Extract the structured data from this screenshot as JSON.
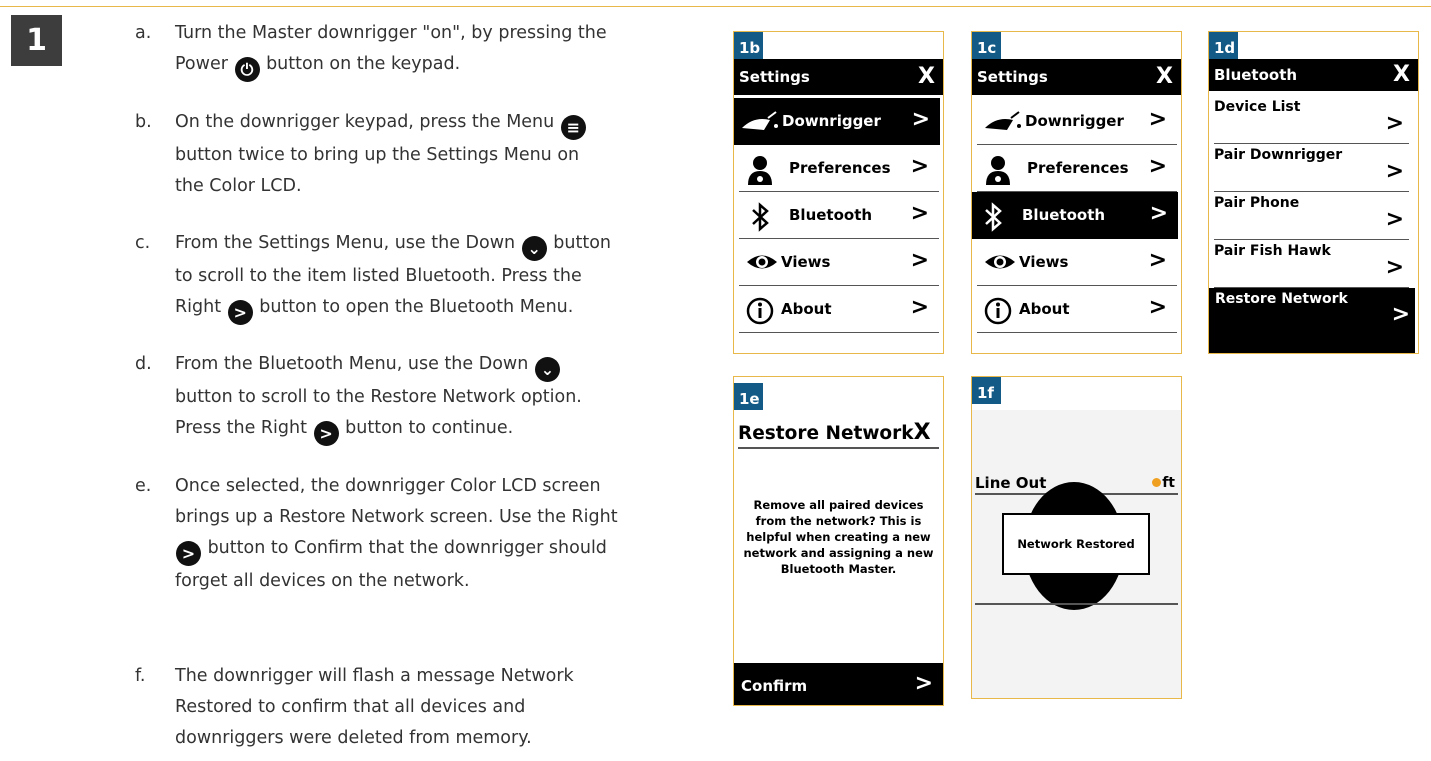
{
  "step_number": "1",
  "instructions": [
    {
      "letter": "a.",
      "l1": "Turn the Master downrigger \"on\", by pressing the",
      "l2a": "Power",
      "l2b": "button on the keypad."
    },
    {
      "letter": "b.",
      "l1a": "On the downrigger keypad, press the Menu",
      "l2": "button twice to bring up the Settings Menu on",
      "l3": "the Color LCD."
    },
    {
      "letter": "c.",
      "l1a": "From the Settings Menu, use the Down",
      "l1b": "button",
      "l2": "to scroll to the item listed Bluetooth. Press the",
      "l3a": "Right",
      "l3b": "button to open the Bluetooth Menu."
    },
    {
      "letter": "d.",
      "l1a": "From the Bluetooth Menu, use the Down",
      "l2": "button to scroll to the Restore Network option.",
      "l3a": "Press the Right",
      "l3b": "button to continue."
    },
    {
      "letter": "e.",
      "l1": "Once selected, the downrigger Color LCD screen",
      "l2": "brings up a Restore Network screen. Use the Right",
      "l3b": "button to Confirm that the downrigger should",
      "l4": "forget all devices on the network."
    },
    {
      "letter": "f.",
      "l1": "The downrigger will flash a message Network",
      "l2": "Restored to confirm that all devices and",
      "l3": "downriggers were deleted from memory."
    }
  ],
  "icons": {
    "power": "power-icon",
    "menu": "menu-icon",
    "down": "chevron-down-icon",
    "right": "chevron-right-icon"
  },
  "panels": {
    "p1b": {
      "tag": "1b",
      "title": "Settings",
      "close": "X",
      "items": [
        {
          "label": "Downrigger",
          "arrow": ">",
          "icon": "downrigger-icon",
          "selected": true
        },
        {
          "label": "Preferences",
          "arrow": ">",
          "icon": "user-icon"
        },
        {
          "label": "Bluetooth",
          "arrow": ">",
          "icon": "bluetooth-icon"
        },
        {
          "label": "Views",
          "arrow": ">",
          "icon": "eye-icon"
        },
        {
          "label": "About",
          "arrow": ">",
          "icon": "info-icon"
        }
      ]
    },
    "p1c": {
      "tag": "1c",
      "title": "Settings",
      "close": "X",
      "items": [
        {
          "label": "Downrigger",
          "arrow": ">",
          "icon": "downrigger-icon"
        },
        {
          "label": "Preferences",
          "arrow": ">",
          "icon": "user-icon"
        },
        {
          "label": "Bluetooth",
          "arrow": ">",
          "icon": "bluetooth-icon",
          "selected": true
        },
        {
          "label": "Views",
          "arrow": ">",
          "icon": "eye-icon"
        },
        {
          "label": "About",
          "arrow": ">",
          "icon": "info-icon"
        }
      ]
    },
    "p1d": {
      "tag": "1d",
      "title": "Bluetooth",
      "close": "X",
      "items": [
        {
          "label": "Device List",
          "arrow": ">"
        },
        {
          "label": "Pair Downrigger",
          "arrow": ">"
        },
        {
          "label": "Pair Phone",
          "arrow": ">"
        },
        {
          "label": "Pair Fish Hawk",
          "arrow": ">"
        },
        {
          "label": "Restore Network",
          "arrow": ">",
          "selected": true
        }
      ]
    },
    "p1e": {
      "tag": "1e",
      "title": "Restore Network",
      "close": "X",
      "message": [
        "Remove all paired devices",
        "from the network? This is",
        "helpful when creating a new",
        "network and assigning a new",
        "Bluetooth Master."
      ],
      "confirm": "Confirm",
      "arrow": ">"
    },
    "p1f": {
      "tag": "1f",
      "line_out": "Line Out",
      "unit": "ft",
      "popup": "Network Restored"
    }
  },
  "colors": {
    "accent_border": "#e8b84a",
    "tag_blue": "#135a86",
    "step_box": "#3d3d3d",
    "unit_icon": "#f0a020"
  }
}
